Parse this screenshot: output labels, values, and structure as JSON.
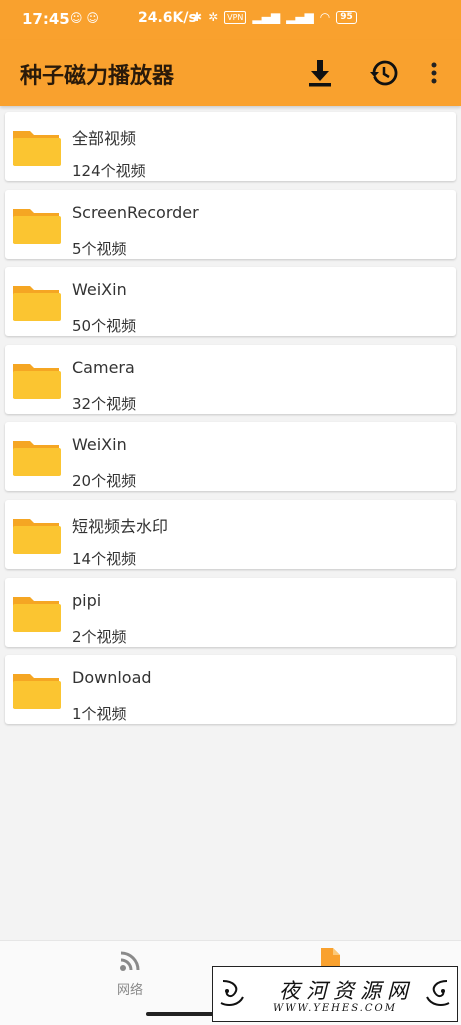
{
  "status_bar": {
    "time": "17:45",
    "speed": "24.6K/s",
    "vpn": "VPN",
    "battery": "95"
  },
  "app_bar": {
    "title": "种子磁力播放器",
    "icons": [
      "download-icon",
      "history-icon",
      "more-vert-icon"
    ]
  },
  "folders": [
    {
      "name": "全部视频",
      "count": "124个视频"
    },
    {
      "name": "ScreenRecorder",
      "count": "5个视频"
    },
    {
      "name": "WeiXin",
      "count": "50个视频"
    },
    {
      "name": "Camera",
      "count": "32个视频"
    },
    {
      "name": "WeiXin",
      "count": "20个视频"
    },
    {
      "name": "短视频去水印",
      "count": "14个视频"
    },
    {
      "name": "pipi",
      "count": "2个视频"
    },
    {
      "name": "Download",
      "count": "1个视频"
    }
  ],
  "bottom_nav": {
    "network_label": "网络"
  },
  "watermark": {
    "main": "夜河资源网",
    "sub": "WWW.YEHES.COM"
  },
  "colors": {
    "accent": "#f9a12e",
    "folder": "#fbc531",
    "folder_tab": "#f5a623"
  }
}
